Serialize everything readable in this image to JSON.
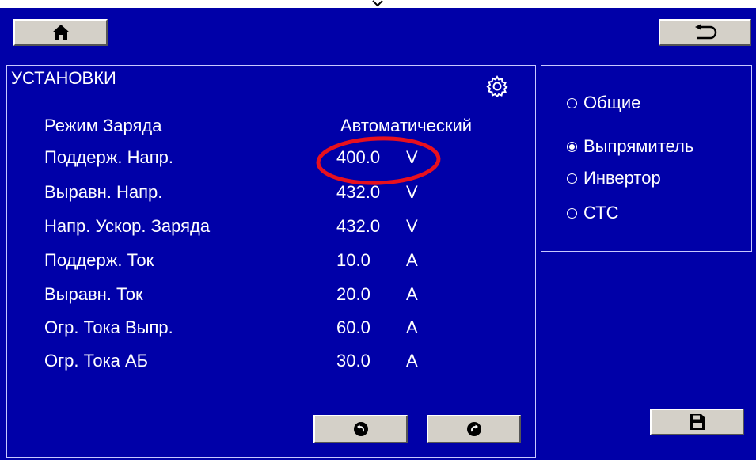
{
  "settings": {
    "title": "УСТАНОВКИ",
    "rows": [
      {
        "label": "Режим Заряда",
        "value": "Автоматический",
        "unit": ""
      },
      {
        "label": "Поддерж. Напр.",
        "value": "400.0",
        "unit": "V"
      },
      {
        "label": "Выравн. Напр.",
        "value": "432.0",
        "unit": "V"
      },
      {
        "label": "Напр. Ускор. Заряда",
        "value": "432.0",
        "unit": "V"
      },
      {
        "label": "Поддерж. Ток",
        "value": "10.0",
        "unit": "A"
      },
      {
        "label": "Выравн. Ток",
        "value": "20.0",
        "unit": "A"
      },
      {
        "label": "Огр. Тока Выпр.",
        "value": "60.0",
        "unit": "A"
      },
      {
        "label": "Огр. Тока АБ",
        "value": "30.0",
        "unit": "A"
      }
    ]
  },
  "categories": {
    "items": [
      {
        "label": "Общие",
        "selected": false
      },
      {
        "label": "Выпрямитель",
        "selected": true
      },
      {
        "label": "Инвертор",
        "selected": false
      },
      {
        "label": "СТС",
        "selected": false
      }
    ]
  },
  "icons": {
    "home": "home-icon",
    "back": "back-arrow-icon",
    "settings": "gear-icon",
    "prev": "prev-page-icon",
    "next": "next-page-icon",
    "save": "save-icon"
  },
  "colors": {
    "background": "#0000a8",
    "button": "#d4d0c8",
    "highlight": "#e8101e",
    "text": "#ffffff"
  }
}
